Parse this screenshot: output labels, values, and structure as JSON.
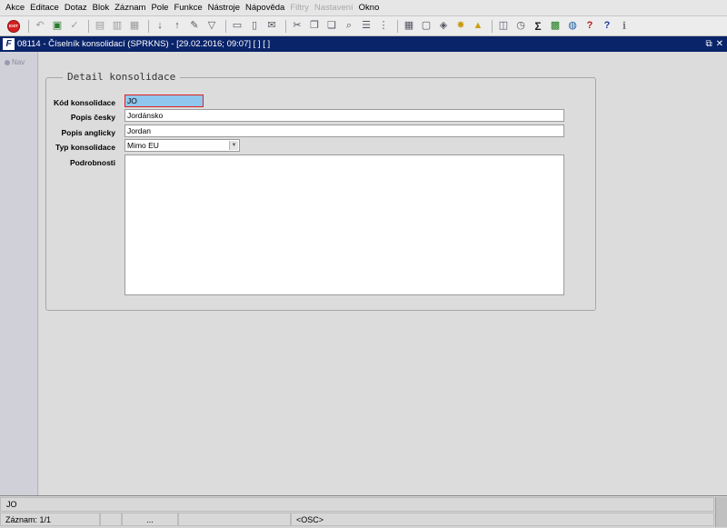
{
  "menu": [
    "Akce",
    "Editace",
    "Dotaz",
    "Blok",
    "Záznam",
    "Pole",
    "Funkce",
    "Nástroje",
    "Nápověda",
    "Filtry",
    "Nastavení",
    "Okno"
  ],
  "menu_disabled": [
    "Filtry",
    "Nastavení"
  ],
  "toolbar": {
    "exit_label": "EXIT",
    "sum_glyph": "Σ",
    "help_glyph": "?",
    "info_glyph": "i"
  },
  "window": {
    "title": "08114 - Číselník konsolidací (SPRKNS) - [29.02.2016; 09:07] [ ] [ ]",
    "restore_glyph": "⧉",
    "close_glyph": "✕"
  },
  "nav": {
    "label": "Nav"
  },
  "form": {
    "group_title": "Detail konsolidace",
    "fields": {
      "kod": {
        "label": "Kód konsolidace",
        "value": "JO"
      },
      "popis_cesky": {
        "label": "Popis česky",
        "value": "Jordánsko"
      },
      "popis_anglicky": {
        "label": "Popis anglicky",
        "value": "Jordan"
      },
      "typ": {
        "label": "Typ konsolidace",
        "value": "Mimo EU"
      },
      "podrobnosti": {
        "label": "Podrobnosti",
        "value": ""
      }
    }
  },
  "status": {
    "current_value": "JO",
    "record": "Záznam: 1/1",
    "ellipsis": "...",
    "mode": "<OSC>"
  }
}
